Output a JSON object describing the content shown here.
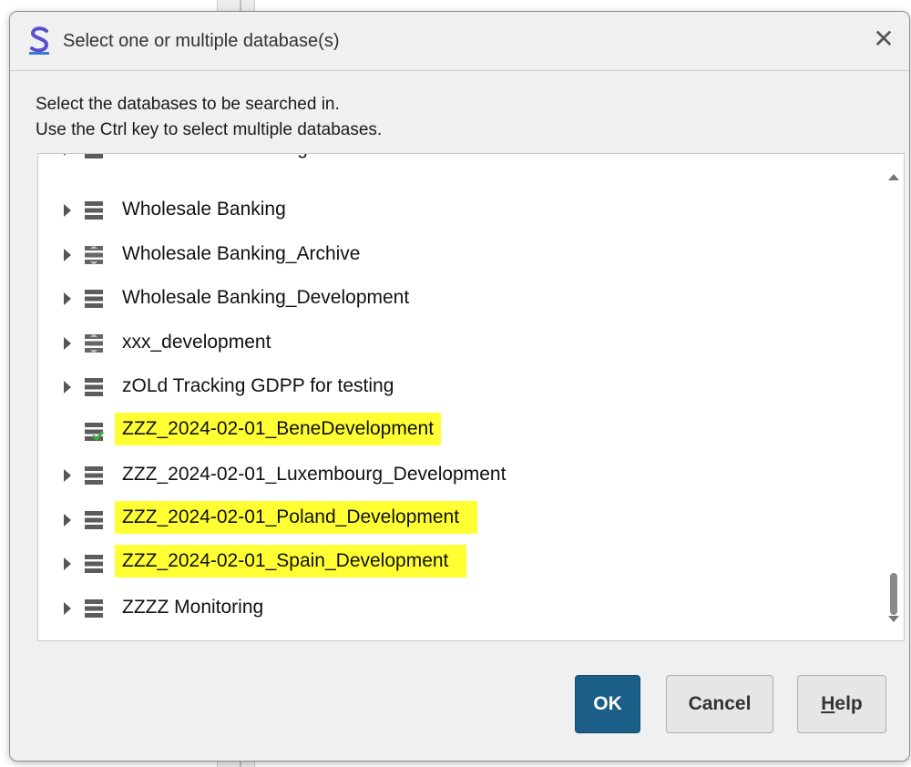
{
  "dialog": {
    "title": "Select one or multiple database(s)",
    "close_label": "✕",
    "instructions_line1": "Select the databases to be searched in.",
    "instructions_line2": "Use the Ctrl key to select multiple databases."
  },
  "list": {
    "partial_top_label": "Variant Rollout testing",
    "items": [
      {
        "label": "Wholesale Banking",
        "icon": "database-icon",
        "expandable": true,
        "highlighted": false
      },
      {
        "label": "Wholesale Banking_Archive",
        "icon": "database-archive-icon",
        "expandable": true,
        "highlighted": false
      },
      {
        "label": "Wholesale Banking_Development",
        "icon": "database-icon",
        "expandable": true,
        "highlighted": false
      },
      {
        "label": "xxx_development",
        "icon": "database-archive-icon",
        "expandable": true,
        "highlighted": false
      },
      {
        "label": "zOLd Tracking GDPP for testing",
        "icon": "database-icon",
        "expandable": true,
        "highlighted": false
      },
      {
        "label": "ZZZ_2024-02-01_BeneDevelopment",
        "icon": "database-checked-icon",
        "expandable": false,
        "highlighted": true
      },
      {
        "label": "ZZZ_2024-02-01_Luxembourg_Development",
        "icon": "database-icon",
        "expandable": true,
        "highlighted": false
      },
      {
        "label": "ZZZ_2024-02-01_Poland_Development",
        "icon": "database-icon",
        "expandable": true,
        "highlighted": true
      },
      {
        "label": "ZZZ_2024-02-01_Spain_Development",
        "icon": "database-icon",
        "expandable": true,
        "highlighted": true
      },
      {
        "label": "ZZZZ Monitoring",
        "icon": "database-icon",
        "expandable": true,
        "highlighted": false
      }
    ]
  },
  "buttons": {
    "ok": "OK",
    "cancel": "Cancel",
    "help_mnemonic": "H",
    "help_rest": "elp"
  },
  "colors": {
    "highlight": "#ffff33",
    "ok_button": "#1b5f88",
    "app_icon": "#5a4fcf"
  }
}
